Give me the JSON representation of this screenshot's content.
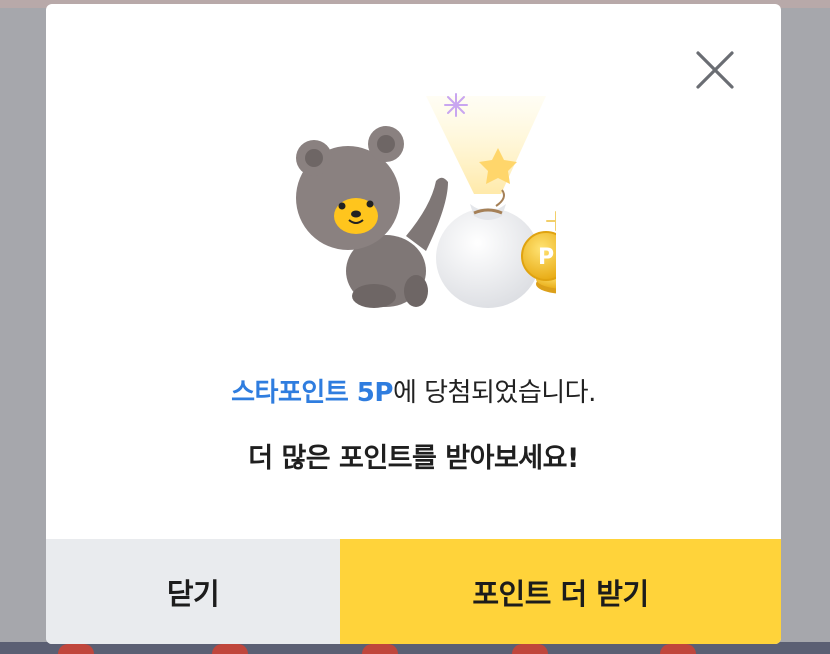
{
  "modal": {
    "message_highlight": "스타포인트 5P",
    "message_rest": "에 당첨되었습니다.",
    "submessage": "더 많은 포인트를 받아보세요!",
    "close_icon": "close-icon",
    "illustration": "bear-with-money-bag-and-point-coins",
    "coin_letter": "P"
  },
  "buttons": {
    "close_label": "닫기",
    "more_points_label": "포인트 더 받기"
  },
  "colors": {
    "accent_blue": "#2f7ddf",
    "primary_yellow": "#ffd33a",
    "secondary_gray": "#e9ebee",
    "overlay": "#a6a7ac"
  }
}
